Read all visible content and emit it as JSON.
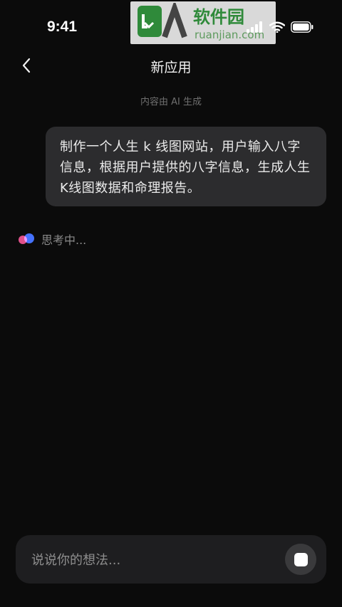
{
  "status_bar": {
    "time": "9:41",
    "icons": [
      "signal-icon",
      "wifi-icon",
      "battery-icon"
    ]
  },
  "watermark": {
    "brand_text": "软件园",
    "domain_text": "ruanjian.com"
  },
  "header": {
    "title": "新应用",
    "back_icon": "chevron-left-icon"
  },
  "ai_note": "内容由 AI 生成",
  "conversation": {
    "user_message": "制作一个人生 k 线图网站，用户输入八字信息，根据用户提供的八字信息，生成人生K线图数据和命理报告。",
    "thinking_text": "思考中..."
  },
  "composer": {
    "placeholder": "说说你的想法...",
    "value": "",
    "stop_icon": "stop-icon"
  },
  "colors": {
    "background": "#0b0b0b",
    "bubble": "#2c2c2e",
    "composer": "#1e1e20",
    "thinking_pink": "#e0508a",
    "thinking_blue": "#3d6cff"
  }
}
